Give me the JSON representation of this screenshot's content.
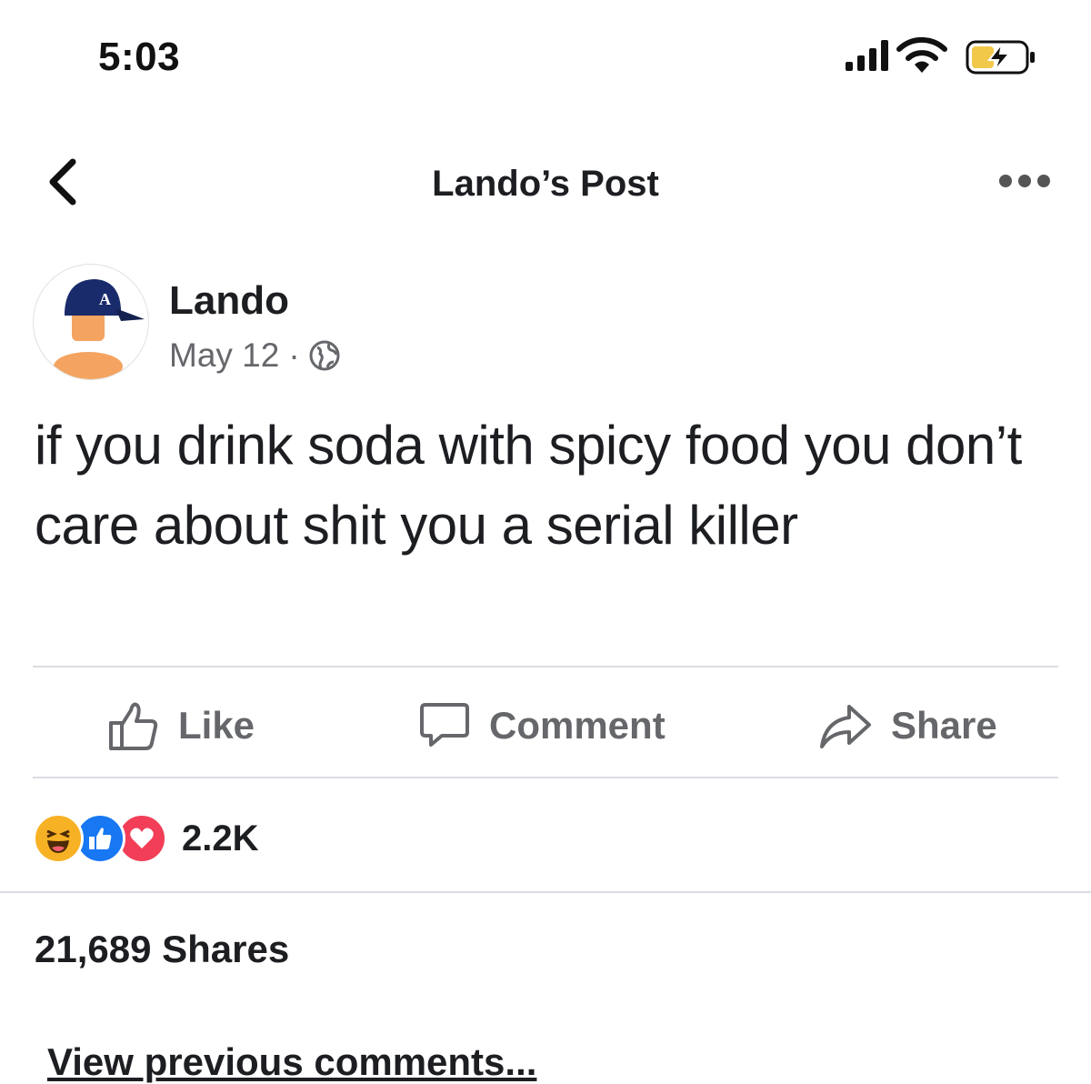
{
  "status_bar": {
    "time": "5:03",
    "signal_icon": "cellular-signal-icon",
    "wifi_icon": "wifi-icon",
    "battery_icon": "battery-charging-icon",
    "battery_color": "#f2c84b"
  },
  "nav": {
    "back_icon": "chevron-left-icon",
    "title": "Lando’s Post",
    "more_icon": "more-horizontal-icon"
  },
  "post": {
    "author": "Lando",
    "date": "May 12",
    "separator": "·",
    "privacy_icon": "globe-icon",
    "text": "if you drink soda with spicy food you don’t care about shit you a serial killer"
  },
  "actions": {
    "like": "Like",
    "comment": "Comment",
    "share": "Share"
  },
  "reactions": {
    "icons": [
      "haha-reaction-icon",
      "like-reaction-icon",
      "love-reaction-icon"
    ],
    "count": "2.2K",
    "colors": {
      "haha": "#f7b125",
      "like": "#1877f2",
      "love": "#f33e58"
    }
  },
  "shares": "21,689 Shares",
  "comments": {
    "view_previous": "View previous comments..."
  }
}
